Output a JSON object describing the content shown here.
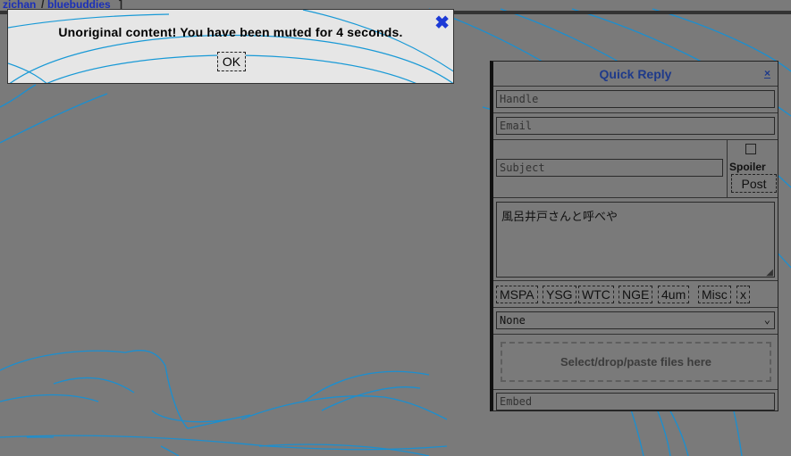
{
  "topbar": {
    "link1": "zichan",
    "sep": "/",
    "link2": "bluebuddies",
    "bracket": "]"
  },
  "popup": {
    "message": "Unoriginal content! You have been muted for 4 seconds.",
    "close_glyph": "✖",
    "ok_label": "OK"
  },
  "quick_reply": {
    "title": "Quick Reply",
    "close_glyph": "×",
    "handle_placeholder": "Handle",
    "email_placeholder": "Email",
    "subject_placeholder": "Subject",
    "spoiler_label": "Spoiler",
    "post_label": "Post",
    "message_value": "風呂井戸さんと呼べや",
    "tags": [
      "MSPA",
      "YSG",
      "WTC",
      "NGE",
      "4um",
      "Misc",
      "x"
    ],
    "select_value": "None",
    "dropzone_text": "Select/drop/paste files here",
    "embed_placeholder": "Embed"
  },
  "colors": {
    "accent": "#1c3ad6",
    "line_art": "#1899d6",
    "background": "#7a7a7a"
  }
}
